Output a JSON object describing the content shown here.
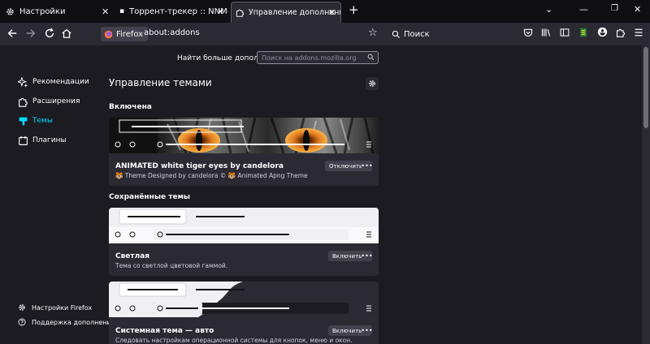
{
  "tabs": [
    {
      "title": "Настройки",
      "icon": "gear-icon"
    },
    {
      "title": "Торрент-трекер :: NNM-Club",
      "icon": "sound-icon"
    },
    {
      "title": "Управление дополнениями",
      "icon": "puzzle-icon"
    }
  ],
  "toolbar": {
    "identity_label": "Firefox",
    "url": "about:addons",
    "search_placeholder": "Поиск"
  },
  "find": {
    "label": "Найти больше дополнений",
    "placeholder": "Поиск на addons.mozilla.org"
  },
  "sidebar": {
    "items": [
      {
        "label": "Рекомендации",
        "icon": "sparkle-icon"
      },
      {
        "label": "Расширения",
        "icon": "puzzle-icon"
      },
      {
        "label": "Темы",
        "icon": "brush-icon"
      },
      {
        "label": "Плагины",
        "icon": "plugin-icon"
      }
    ],
    "footer": [
      {
        "label": "Настройки Firefox",
        "icon": "gear-icon"
      },
      {
        "label": "Поддержка дополнений",
        "icon": "help-icon"
      }
    ]
  },
  "main": {
    "title": "Управление темами",
    "enabled_heading": "Включена",
    "saved_heading": "Сохранённые темы",
    "themes": [
      {
        "name": "ANIMATED white tiger eyes by candelora",
        "description": "🐯 Theme Designed by candelora © 🐯 Animated Apng Theme",
        "button": "Отключить"
      },
      {
        "name": "Светлая",
        "description": "Тема со светлой цветовой гаммой.",
        "button": "Включить"
      },
      {
        "name": "Системная тема — авто",
        "description": "Следовать настройкам операционной системы для кнопок, меню и окон.",
        "button": "Включить"
      }
    ],
    "more_label": "•••"
  },
  "colors": {
    "accent": "#00ddff",
    "tiger_eye": "#e07a1f"
  }
}
